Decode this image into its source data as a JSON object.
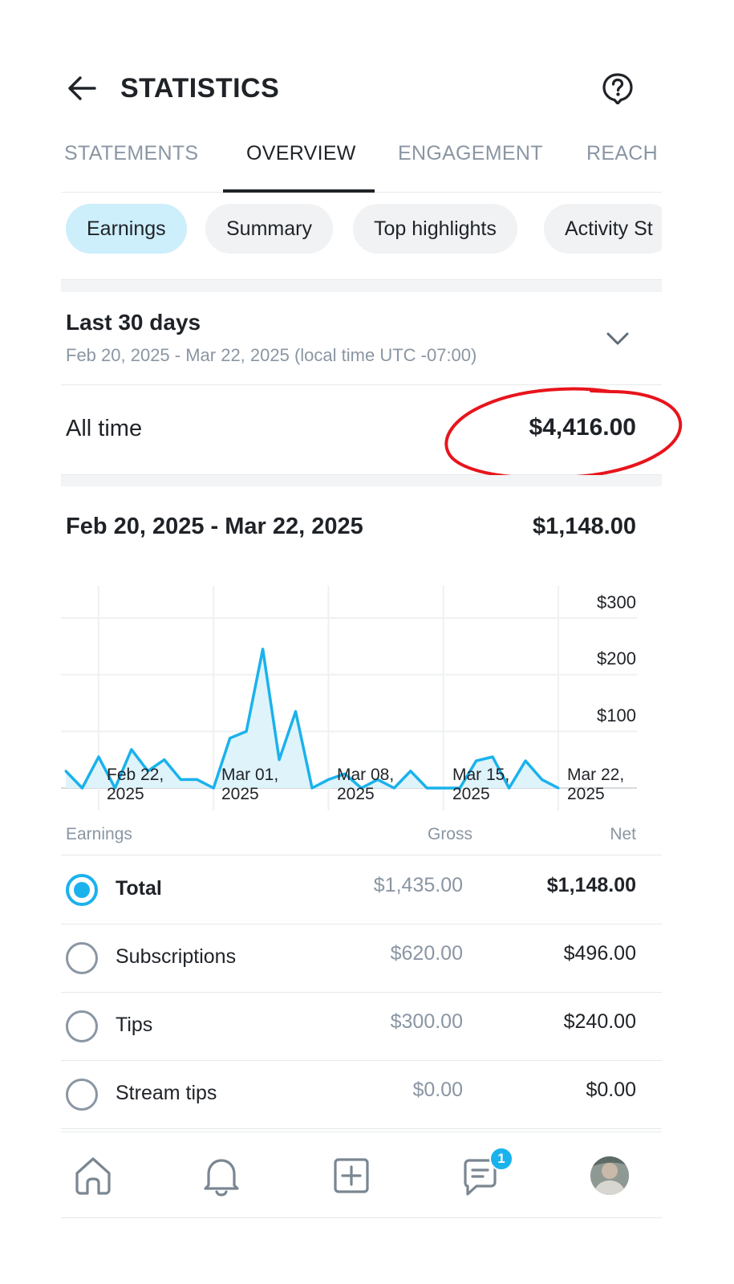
{
  "header": {
    "title": "STATISTICS"
  },
  "tabs": [
    {
      "label": "STATEMENTS",
      "active": false
    },
    {
      "label": "OVERVIEW",
      "active": true
    },
    {
      "label": "ENGAGEMENT",
      "active": false
    },
    {
      "label": "REACH",
      "active": false
    }
  ],
  "chips": [
    {
      "label": "Earnings",
      "selected": true
    },
    {
      "label": "Summary",
      "selected": false
    },
    {
      "label": "Top highlights",
      "selected": false
    },
    {
      "label": "Activity St",
      "selected": false
    }
  ],
  "period": {
    "title": "Last 30 days",
    "range": "Feb 20, 2025 - Mar 22, 2025 (local time UTC -07:00)"
  },
  "all_time": {
    "label": "All time",
    "value": "$4,416.00"
  },
  "range_summary": {
    "label": "Feb 20, 2025 - Mar 22, 2025",
    "value": "$1,148.00"
  },
  "chart_data": {
    "type": "area",
    "x": [
      "2025-02-20",
      "2025-02-21",
      "2025-02-22",
      "2025-02-23",
      "2025-02-24",
      "2025-02-25",
      "2025-02-26",
      "2025-02-27",
      "2025-02-28",
      "2025-03-01",
      "2025-03-02",
      "2025-03-03",
      "2025-03-04",
      "2025-03-05",
      "2025-03-06",
      "2025-03-07",
      "2025-03-08",
      "2025-03-09",
      "2025-03-10",
      "2025-03-11",
      "2025-03-12",
      "2025-03-13",
      "2025-03-14",
      "2025-03-15",
      "2025-03-16",
      "2025-03-17",
      "2025-03-18",
      "2025-03-19",
      "2025-03-20",
      "2025-03-21",
      "2025-03-22"
    ],
    "series": [
      {
        "values": [
          30,
          0,
          55,
          0,
          68,
          30,
          50,
          15,
          15,
          0,
          88,
          100,
          245,
          50,
          135,
          0,
          15,
          25,
          0,
          15,
          0,
          30,
          0,
          0,
          0,
          48,
          55,
          0,
          48,
          15,
          0
        ]
      }
    ],
    "ylim": [
      0,
      300
    ],
    "y_ticks": [
      "$300",
      "$200",
      "$100"
    ],
    "x_ticks": [
      "Feb 22,\n2025",
      "Mar 01,\n2025",
      "Mar 08,\n2025",
      "Mar 15,\n2025",
      "Mar 22,\n2025"
    ],
    "line_color": "#1ab2ec",
    "fill_color": "#dff3fb",
    "grid": true
  },
  "table": {
    "headers": {
      "earnings": "Earnings",
      "gross": "Gross",
      "net": "Net"
    },
    "rows": [
      {
        "label": "Total",
        "gross": "$1,435.00",
        "net": "$1,148.00",
        "selected": true
      },
      {
        "label": "Subscriptions",
        "gross": "$620.00",
        "net": "$496.00",
        "selected": false
      },
      {
        "label": "Tips",
        "gross": "$300.00",
        "net": "$240.00",
        "selected": false
      },
      {
        "label": "Stream tips",
        "gross": "$0.00",
        "net": "$0.00",
        "selected": false
      }
    ]
  },
  "bottom_nav": {
    "items": [
      "home-icon",
      "bell-icon",
      "plus-square-icon",
      "chat-icon",
      "avatar"
    ],
    "messages_badge": "1"
  },
  "colors": {
    "accent": "#1ab2ec",
    "chip_selected": "#cdeefb",
    "annotation": "#e8141c"
  }
}
